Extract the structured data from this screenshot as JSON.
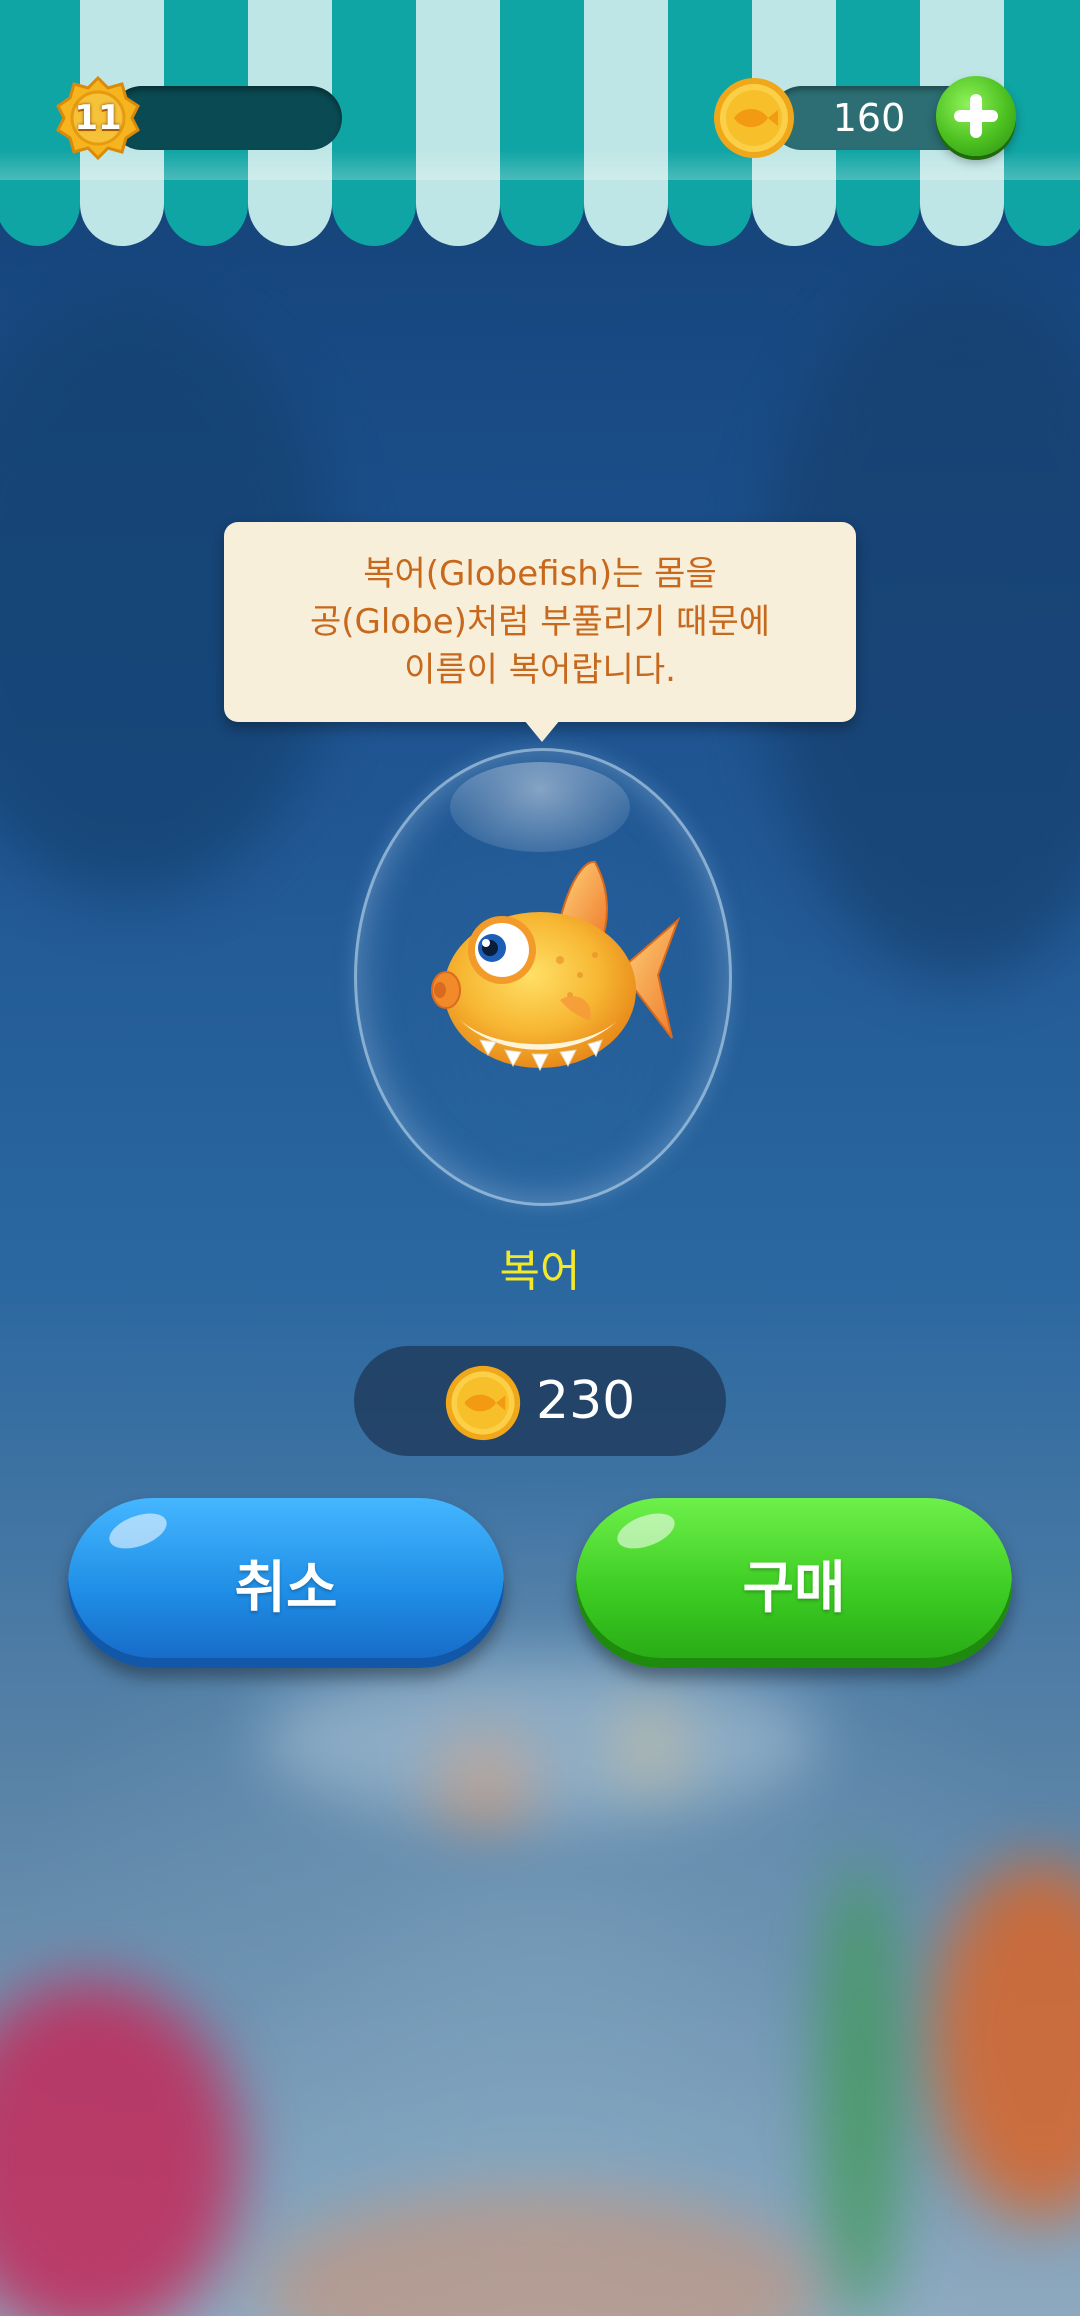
{
  "hud": {
    "level": "11",
    "coins": "160"
  },
  "popup": {
    "description_lines": [
      "복어(Globefish)는 몸을",
      "공(Globe)처럼 부풀리기 때문에",
      "이름이 복어랍니다."
    ],
    "fish_name": "복어",
    "price": "230",
    "cancel_label": "취소",
    "buy_label": "구매"
  },
  "colors": {
    "awning_dark": "#0fa5a4",
    "awning_light": "#bfe6e6",
    "tooltip_bg": "#f7efd9",
    "tooltip_text": "#c7681c",
    "fish_name_color": "#f3e82a",
    "cancel_button": "#1f8ee6",
    "buy_button": "#3ccc23"
  },
  "icons": {
    "level": "star-badge-icon",
    "coin": "fish-coin-icon",
    "add": "plus-icon"
  }
}
